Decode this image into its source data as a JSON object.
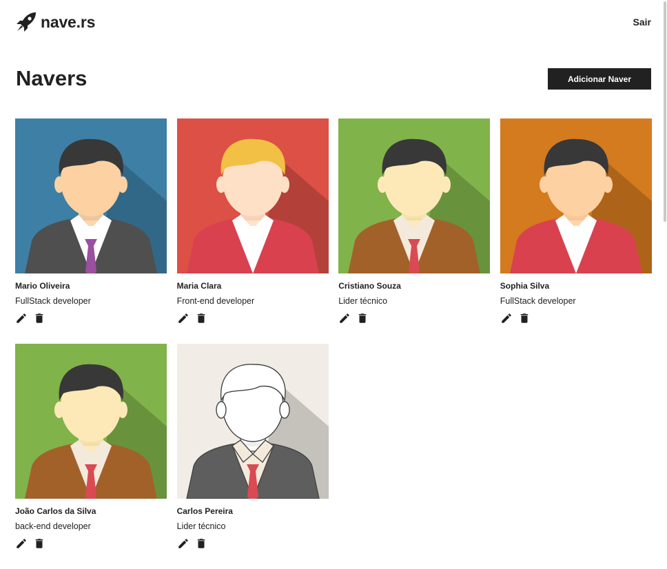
{
  "header": {
    "logo_text": "nave.rs",
    "logout_label": "Sair"
  },
  "page": {
    "title": "Navers",
    "add_button_label": "Adicionar Naver"
  },
  "navers": [
    {
      "name": "Mario Oliveira",
      "job": "FullStack developer",
      "avatar": {
        "bg": "#3e7fa5",
        "hair": "#383838",
        "suit": "#4f4f4f",
        "shirt": "#ffffff",
        "tie": "#9b4fa0",
        "skin": "#fdd1a2"
      }
    },
    {
      "name": "Maria Clara",
      "job": "Front-end developer",
      "avatar": {
        "bg": "#dc5046",
        "hair": "#f2c044",
        "suit": "#d9414f",
        "shirt": "#ffffff",
        "tie": "",
        "skin": "#fde0c5"
      }
    },
    {
      "name": "Cristiano Souza",
      "job": "Lider técnico",
      "avatar": {
        "bg": "#80b34a",
        "hair": "#383838",
        "suit": "#a3612a",
        "shirt": "#f4eadc",
        "tie": "#d94a53",
        "skin": "#fde9b8"
      }
    },
    {
      "name": "Sophia Silva",
      "job": "FullStack developer",
      "avatar": {
        "bg": "#d47a1f",
        "hair": "#383838",
        "suit": "#d9414f",
        "shirt": "#ffffff",
        "tie": "",
        "skin": "#fdd1a2"
      }
    },
    {
      "name": "João Carlos da Silva",
      "job": "back-end developer",
      "avatar": {
        "bg": "#80b34a",
        "hair": "#383838",
        "suit": "#a3612a",
        "shirt": "#f4eadc",
        "tie": "#d94a53",
        "skin": "#fde9b8"
      }
    },
    {
      "name": "Carlos Pereira",
      "job": "Lider técnico",
      "avatar": {
        "bg": "#f1ede6",
        "hair": "#ffffff",
        "suit": "#5e5e5e",
        "shirt": "#f4eadc",
        "tie": "#d94a53",
        "skin": "#ffffff"
      }
    }
  ]
}
